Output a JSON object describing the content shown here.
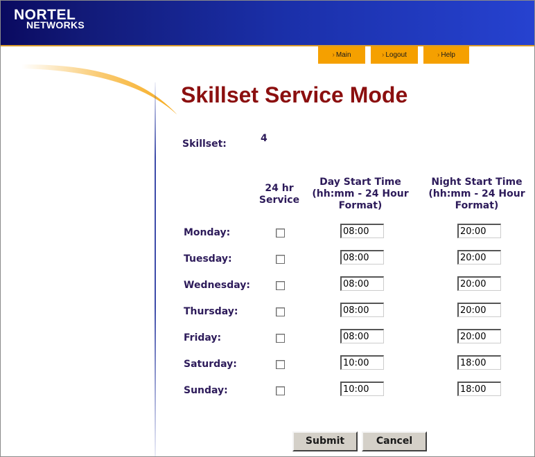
{
  "logo": {
    "line1": "NORTEL",
    "line2": "NETWORKS"
  },
  "nav": {
    "main": "Main",
    "logout": "Logout",
    "help": "Help",
    "bullet": "›"
  },
  "page": {
    "title": "Skillset Service Mode"
  },
  "skillset": {
    "label": "Skillset:",
    "value": "4"
  },
  "columns": {
    "service": [
      "24 hr",
      "Service"
    ],
    "day": [
      "Day Start Time",
      "(hh:mm - 24 Hour",
      "Format)"
    ],
    "night": [
      "Night Start Time",
      "(hh:mm - 24 Hour",
      "Format)"
    ]
  },
  "days": [
    {
      "label": "Monday:",
      "service24": false,
      "day": "08:00",
      "night": "20:00"
    },
    {
      "label": "Tuesday:",
      "service24": false,
      "day": "08:00",
      "night": "20:00"
    },
    {
      "label": "Wednesday:",
      "service24": false,
      "day": "08:00",
      "night": "20:00"
    },
    {
      "label": "Thursday:",
      "service24": false,
      "day": "08:00",
      "night": "20:00"
    },
    {
      "label": "Friday:",
      "service24": false,
      "day": "08:00",
      "night": "20:00"
    },
    {
      "label": "Saturday:",
      "service24": false,
      "day": "10:00",
      "night": "18:00"
    },
    {
      "label": "Sunday:",
      "service24": false,
      "day": "10:00",
      "night": "18:00"
    }
  ],
  "buttons": {
    "submit": "Submit",
    "cancel": "Cancel"
  },
  "colors": {
    "title": "#8b0f0f",
    "label": "#2d1b5a",
    "navtab": "#f5a000",
    "header": "#1a2fa8"
  }
}
